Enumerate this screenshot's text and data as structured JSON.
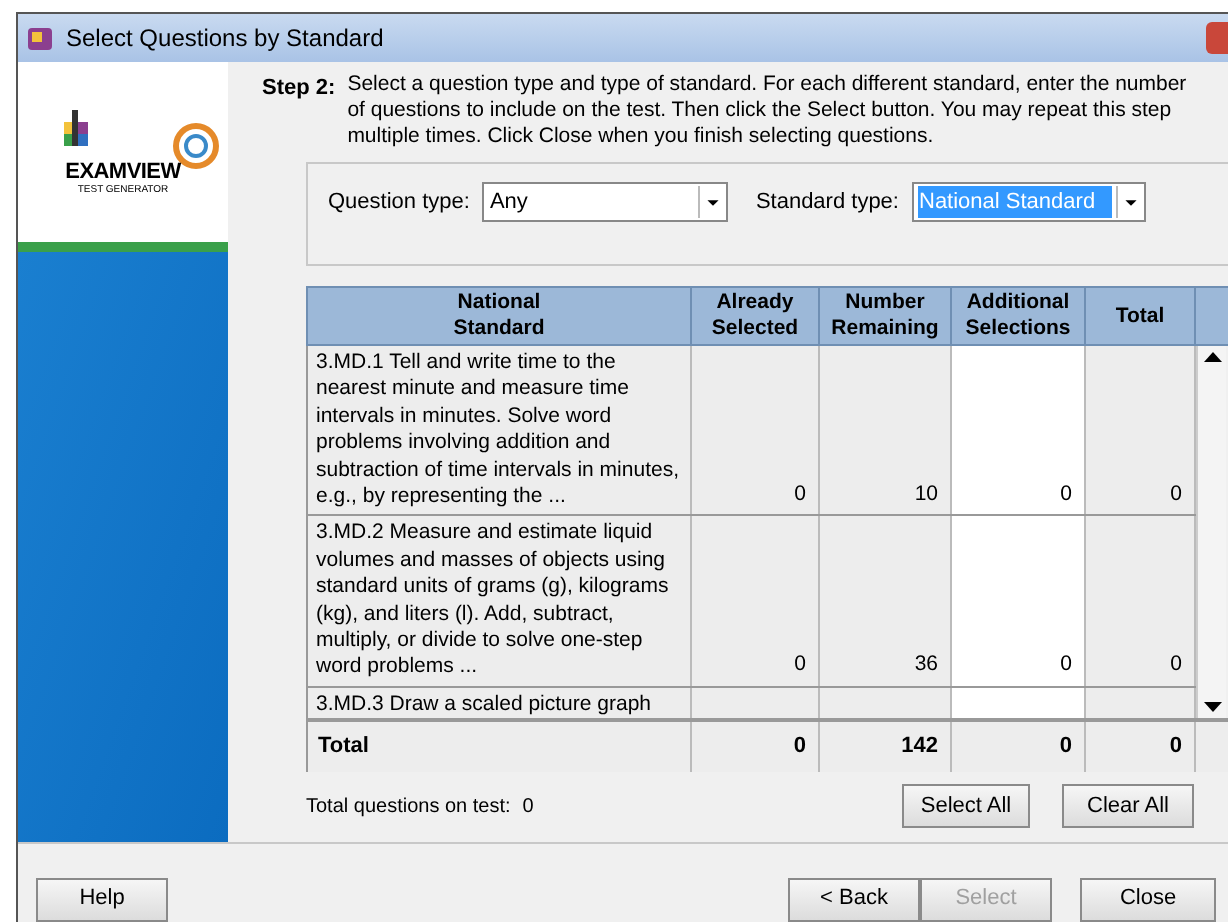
{
  "window": {
    "title": "Select Questions by Standard"
  },
  "logo": {
    "brand": "EXAMVIEW",
    "tagline": "TEST GENERATOR"
  },
  "step": {
    "label": "Step 2:",
    "text": "Select a question type and type of standard. For each different standard, enter the number of questions to include on the test. Then click the Select button. You may repeat this step multiple times. Click Close when you finish selecting questions."
  },
  "filters": [
    {
      "label": "Question type:",
      "value": "Any",
      "text_selected": false
    },
    {
      "label": "Standard type:",
      "value": "National Standard",
      "text_selected": true
    }
  ],
  "table": {
    "columns": [
      "National\nStandard",
      "Already\nSelected",
      "Number\nRemaining",
      "Additional\nSelections",
      "Total"
    ],
    "rows": [
      {
        "standard": "3.MD.1 Tell and write time to the nearest minute and measure time intervals in minutes. Solve word problems involving addition and subtraction of time intervals in minutes, e.g., by representing the ...",
        "already_selected": "0",
        "number_remaining": "10",
        "additional_selections": "0",
        "total": "0"
      },
      {
        "standard": "3.MD.2 Measure and estimate liquid volumes and masses of objects using standard units of grams (g), kilograms (kg), and liters (l). Add, subtract, multiply, or divide to solve one-step word problems ...",
        "already_selected": "0",
        "number_remaining": "36",
        "additional_selections": "0",
        "total": "0"
      },
      {
        "standard": "3.MD.3 Draw a scaled picture graph"
      }
    ],
    "total_row": [
      "Total",
      "0",
      "142",
      "0",
      "0"
    ]
  },
  "total_questions": {
    "label": "Total questions on test:",
    "value": "0"
  },
  "table_buttons": [
    {
      "label": "Select All",
      "disabled": false
    },
    {
      "label": "Clear All",
      "disabled": false
    }
  ],
  "footer_buttons": [
    {
      "label": "Help",
      "disabled": false
    },
    {
      "label": "< Back",
      "disabled": false
    },
    {
      "label": "Select",
      "disabled": true
    },
    {
      "label": "Close",
      "disabled": false
    }
  ]
}
